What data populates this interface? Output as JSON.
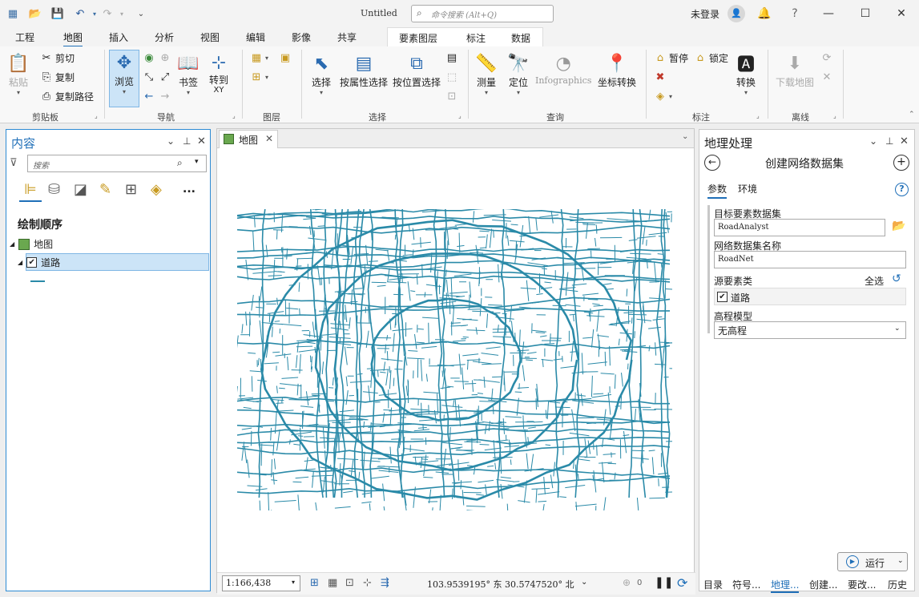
{
  "title_bar": {
    "doc_title": "Untitled",
    "search_placeholder": "命令搜索 (Alt+Q)",
    "login": "未登录",
    "help": "?",
    "minimize": "—",
    "maximize": "☐",
    "close": "✕"
  },
  "tabs": [
    "工程",
    "地图",
    "插入",
    "分析",
    "视图",
    "编辑",
    "影像",
    "共享"
  ],
  "active_tab": "地图",
  "context_tabs": [
    "要素图层",
    "标注",
    "数据"
  ],
  "ribbon": {
    "clipboard": {
      "paste": "粘贴",
      "cut": "剪切",
      "copy": "复制",
      "copy_path": "复制路径",
      "label": "剪贴板"
    },
    "navigate": {
      "explore": "浏览",
      "bookmarks": "书签",
      "goto_xy": "转到",
      "goto_xy2": "XY",
      "label": "导航"
    },
    "layer": {
      "label": "图层"
    },
    "selection": {
      "select": "选择",
      "by_attr": "按属性选择",
      "by_loc": "按位置选择",
      "label": "选择"
    },
    "inquiry": {
      "measure": "测量",
      "locate": "定位",
      "infographics": "Infographics",
      "coord": "坐标转换",
      "label": "查询"
    },
    "labeling": {
      "pause": "暂停",
      "lock": "锁定",
      "convert": "转换",
      "label": "标注"
    },
    "offline": {
      "download": "下载地图",
      "label": "离线"
    }
  },
  "contents": {
    "title": "内容",
    "search_placeholder": "搜索",
    "more": "...",
    "drawing_order": "绘制顺序",
    "map_item": "地图",
    "layer_item": "道路"
  },
  "map_tab": {
    "label": "地图"
  },
  "status": {
    "scale": "1:166,438",
    "coords": "103.9539195° 东  30.5747520° 北",
    "selected_count": "0"
  },
  "gp": {
    "title": "地理处理",
    "tool_name": "创建网络数据集",
    "tab_params": "参数",
    "tab_env": "环境",
    "target_label": "目标要素数据集",
    "target_value": "RoadAnalyst",
    "name_label": "网络数据集名称",
    "name_value": "RoadNet",
    "source_label": "源要素类",
    "select_all": "全选",
    "source_item": "道路",
    "elev_label": "高程模型",
    "elev_value": "无高程",
    "run": "运行"
  },
  "bottom_tabs": [
    "目录",
    "符号...",
    "地理...",
    "创建...",
    "要改...",
    "历史"
  ],
  "colors": {
    "accent": "#1f6fb8",
    "road": "#2a8aa8",
    "selection": "#cce4f7"
  }
}
